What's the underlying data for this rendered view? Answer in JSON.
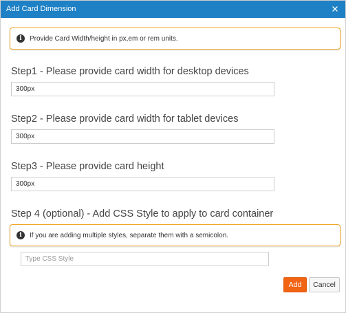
{
  "dialog": {
    "title": "Add Card Dimension",
    "close_symbol": "×"
  },
  "info": {
    "units_note": "Provide Card Width/height in px,em or rem units.",
    "icon": "info-icon"
  },
  "steps": {
    "desktop_width": {
      "label": "Step1 - Please provide card width for desktop devices",
      "value": "300px"
    },
    "tablet_width": {
      "label": "Step2 - Please provide card width for tablet devices",
      "value": "300px"
    },
    "height": {
      "label": "Step3 - Please provide card height",
      "value": "300px"
    },
    "css_style": {
      "label": "Step 4 (optional) - Add CSS Style to apply to card container",
      "note": "If you are adding multiple styles, separate them with a semicolon.",
      "value": "",
      "placeholder": "Type CSS Style"
    }
  },
  "footer": {
    "add_label": "Add",
    "cancel_label": "Cancel"
  },
  "colors": {
    "title_bar": "#1e81c6",
    "info_border": "#f0a020",
    "add_button": "#f06414"
  }
}
